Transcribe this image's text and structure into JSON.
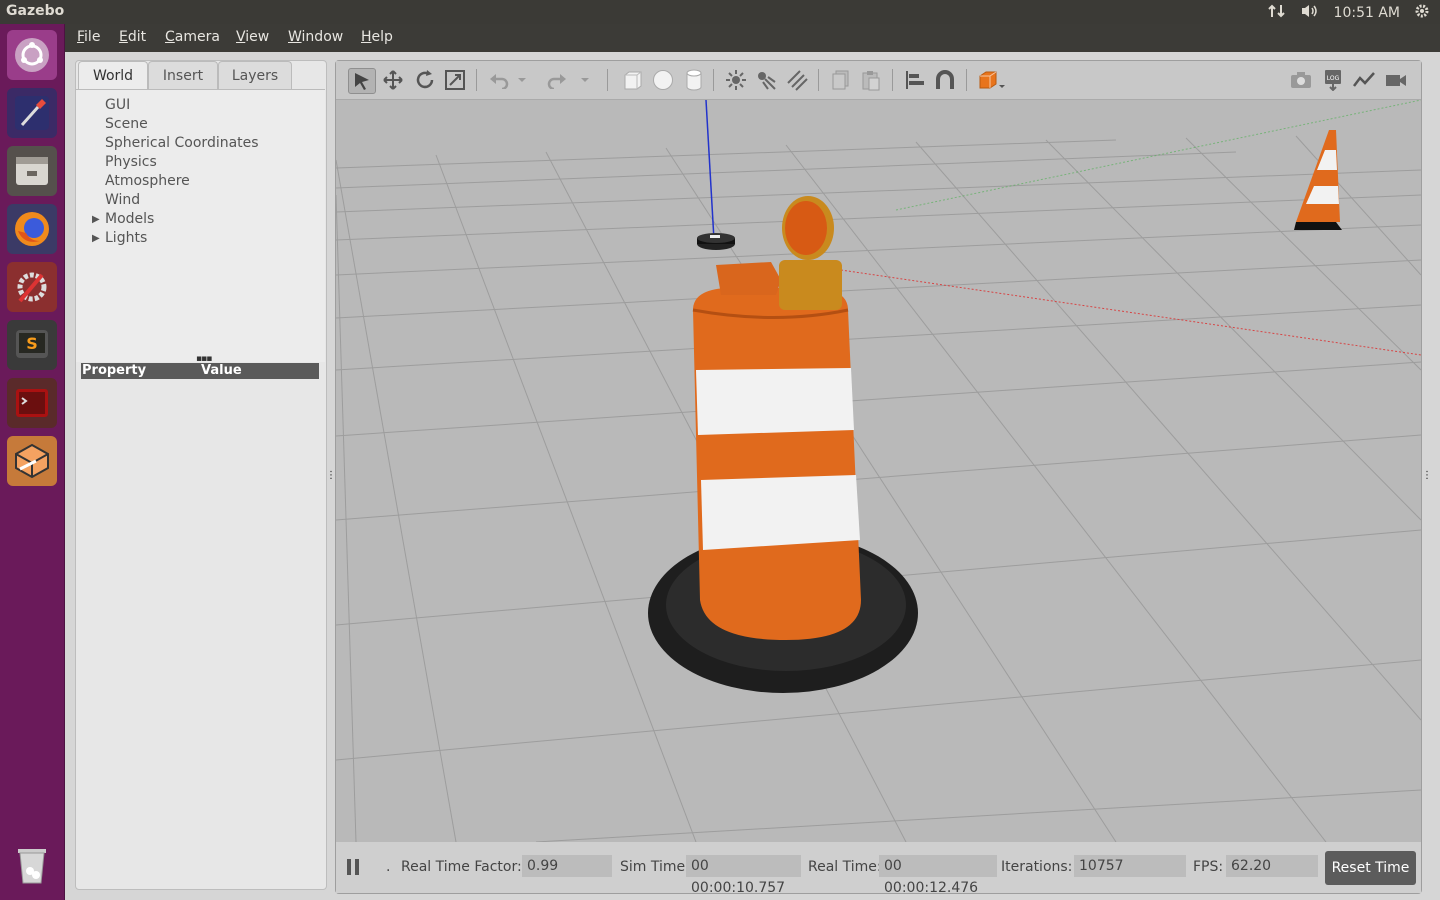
{
  "system_bar": {
    "app_title": "Gazebo",
    "time": "10:51 AM"
  },
  "launcher": {
    "items": [
      "ubuntu-dash-icon",
      "color-picker-icon",
      "file-manager-icon",
      "firefox-icon",
      "system-settings-icon",
      "sublime-text-icon",
      "terminal-icon",
      "gazebo-icon",
      "trash-icon"
    ]
  },
  "menu": {
    "file": "File",
    "edit": "Edit",
    "camera": "Camera",
    "view": "View",
    "window": "Window",
    "help": "Help"
  },
  "left_panel": {
    "tabs": [
      "World",
      "Insert",
      "Layers"
    ],
    "tree": [
      "GUI",
      "Scene",
      "Spherical Coordinates",
      "Physics",
      "Atmosphere",
      "Wind",
      "Models",
      "Lights"
    ],
    "property_header": "Property",
    "value_header": "Value"
  },
  "status": {
    "real_time_factor_label": "Real Time Factor:",
    "real_time_factor": "0.99",
    "sim_time_label": "Sim Time:",
    "sim_time": "00 00:00:10.757",
    "real_time_label": "Real Time:",
    "real_time": "00 00:00:12.476",
    "iterations_label": "Iterations:",
    "iterations": "10757",
    "fps_label": "FPS:",
    "fps": "62.20",
    "reset_label": "Reset Time",
    "dot": "."
  },
  "colors": {
    "launcher_bg": "#6a1a5a",
    "viewport_ground": "#b9b9b9",
    "barrel_orange": "#e06a1d",
    "barrel_stripe": "#f0f0f0",
    "x_axis": "#d64545",
    "z_axis": "#2233cc",
    "y_axis": "#4caf50"
  }
}
